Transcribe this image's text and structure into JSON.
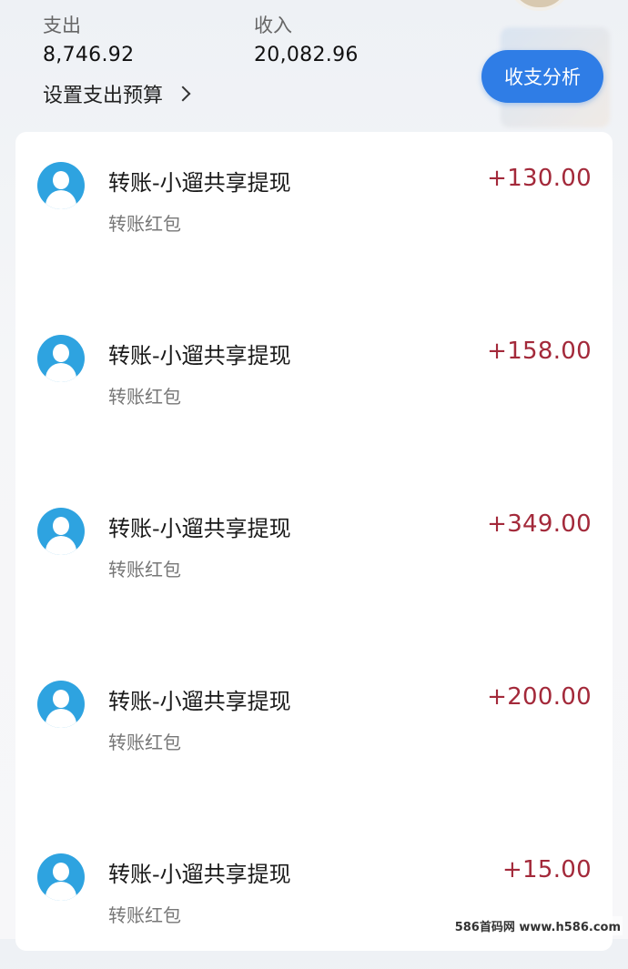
{
  "summary": {
    "expense": {
      "label": "支出",
      "value": "8,746.92"
    },
    "income": {
      "label": "收入",
      "value": "20,082.96"
    },
    "budget_link": "设置支出预算",
    "analysis_button": "收支分析"
  },
  "transactions": [
    {
      "title": "转账-小遛共享提现",
      "subtitle": "转账红包",
      "amount": "+130.00"
    },
    {
      "title": "转账-小遛共享提现",
      "subtitle": "转账红包",
      "amount": "+158.00"
    },
    {
      "title": "转账-小遛共享提现",
      "subtitle": "转账红包",
      "amount": "+349.00"
    },
    {
      "title": "转账-小遛共享提现",
      "subtitle": "转账红包",
      "amount": "+200.00"
    },
    {
      "title": "转账-小遛共享提现",
      "subtitle": "转账红包",
      "amount": "+15.00"
    }
  ],
  "watermark": "586首码网 www.h586.com",
  "colors": {
    "accent": "#2f7de6",
    "amount": "#a3293a",
    "avatar": "#2ea3e0"
  }
}
